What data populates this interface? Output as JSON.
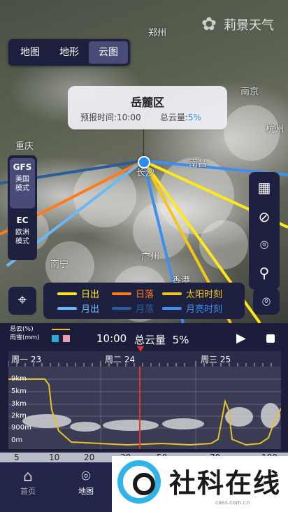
{
  "logo": {
    "text": "莉景天气"
  },
  "layer_tabs": [
    {
      "label": "地图",
      "active": false
    },
    {
      "label": "地形",
      "active": false
    },
    {
      "label": "云图",
      "active": true
    }
  ],
  "map_labels": {
    "zhengzhou": "郑州",
    "nanjing": "南京",
    "hangzhou": "杭州",
    "chongqing": "重庆",
    "changsha": "长沙",
    "nanchang": "南昌",
    "guangzhou": "广州",
    "nanning": "南宁",
    "hongkong": "香港"
  },
  "popup": {
    "title": "岳麓区",
    "time_label": "预报时间:",
    "time_value": "10:00",
    "cloud_label": "总云量:",
    "cloud_value": "5%"
  },
  "models": [
    {
      "code": "GFS",
      "desc1": "美国",
      "desc2": "模式",
      "active": true
    },
    {
      "code": "EC",
      "desc1": "欧洲",
      "desc2": "模式",
      "active": false
    }
  ],
  "tools": [
    "grid-icon",
    "satellite-icon",
    "camera-icon",
    "search-icon"
  ],
  "legend": {
    "sunrise": "日出",
    "sunset": "日落",
    "sun_time": "太阳时刻",
    "moonrise": "月出",
    "moonset": "月落",
    "moon_time": "月亮时刻",
    "colors": {
      "sunrise": "#ffe81a",
      "sunset": "#ff7a1a",
      "sun_time": "#f5c518",
      "moonrise": "#6ab8f5",
      "moonset": "#2a5b9a",
      "moon_time": "#3d8ef0"
    }
  },
  "timeline": {
    "legend_cloud": "总云(%)",
    "legend_rain": "雨雪(mm)",
    "time": "10:00",
    "cloud_label": "总云量",
    "cloud_value": "5%",
    "days": [
      "周一 23",
      "周二 24",
      "周三 25"
    ],
    "y_labels": [
      "9km",
      "5km",
      "3km",
      "2km",
      "900m",
      "0m"
    ]
  },
  "scale_labels": [
    "5",
    "10",
    "20",
    "30",
    "50",
    "70",
    "100"
  ],
  "nav": [
    {
      "label": "首页",
      "icon": "home-icon",
      "active": false
    },
    {
      "label": "地图",
      "icon": "camera-icon",
      "active": true
    }
  ],
  "watermark": {
    "text": "社科在线",
    "url": "cass.com.cn"
  }
}
